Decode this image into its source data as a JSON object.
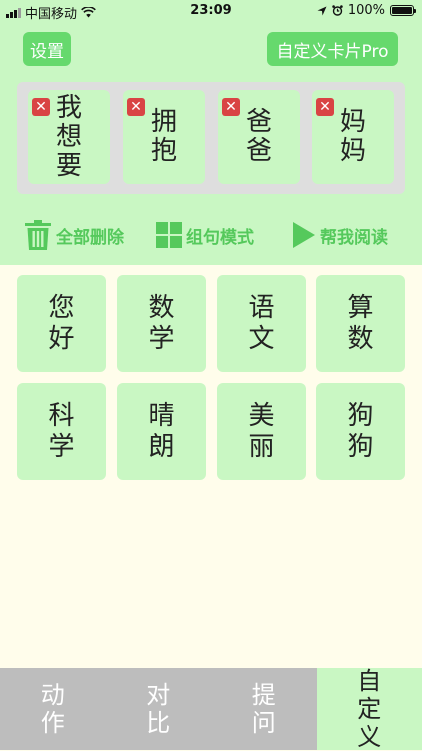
{
  "status_bar": {
    "carrier": "中国移动",
    "time": "23:09",
    "battery": "100%",
    "battery_level": 1.0
  },
  "header": {
    "settings_label": "设置",
    "custom_cards_label": "自定义卡片Pro"
  },
  "sentence": {
    "words": [
      "我想要",
      "拥抱",
      "爸爸",
      "妈妈"
    ],
    "remove_icon": "close-x-icon"
  },
  "actions": {
    "delete_all": "全部删除",
    "sentence_mode": "组句模式",
    "read_for_me": "帮我阅读"
  },
  "cards": [
    "您好",
    "数学",
    "语文",
    "算数",
    "科学",
    "晴朗",
    "美丽",
    "狗狗"
  ],
  "tabs": [
    {
      "label": "动作",
      "active": false
    },
    {
      "label": "对比",
      "active": false
    },
    {
      "label": "提问",
      "active": false
    },
    {
      "label": "自定义",
      "active": true
    }
  ],
  "colors": {
    "accent": "#66d96d",
    "card": "#c9f7c3",
    "remove": "#d94444",
    "tab_inactive": "#bdbdbd"
  }
}
